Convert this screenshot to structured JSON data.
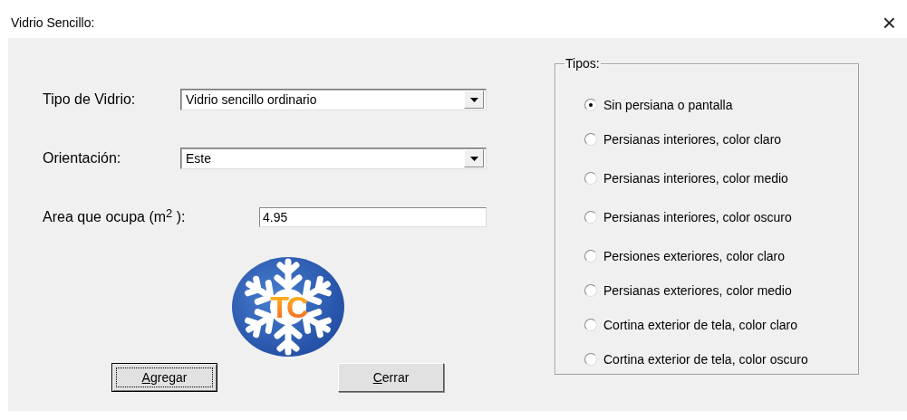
{
  "window": {
    "title": "Vidrio Sencillo:",
    "close": "×"
  },
  "fields": [
    {
      "kind": "combo",
      "label": "Tipo de Vidrio:",
      "value": "Vidrio sencillo ordinario"
    },
    {
      "kind": "combo",
      "label": "Orientación:",
      "value": "Este"
    },
    {
      "kind": "text",
      "label": "Area que ocupa (m$^{2}$ ):",
      "value": "4.95"
    }
  ],
  "logo": {
    "text": "TC"
  },
  "buttons": [
    {
      "label": "Agregar",
      "focused": true,
      "underlined_key": true
    },
    {
      "label": "Cerrar",
      "focused": false,
      "underlined_key": true
    }
  ],
  "group": {
    "title": "Tipos:",
    "options": [
      {
        "label": "Sin persiana o pantalla",
        "selected": true
      },
      {
        "label": "Persianas interiores, color claro",
        "selected": false
      },
      {
        "label": "Persianas interiores, color medio",
        "selected": false
      },
      {
        "label": "Persianas interiores, color oscuro",
        "selected": false
      },
      {
        "label": "Persiones exteriores, color claro",
        "selected": false
      },
      {
        "label": "Persianas exteriores, color medio",
        "selected": false
      },
      {
        "label": "Cortina exterior de tela, color claro",
        "selected": false
      },
      {
        "label": "Cortina exterior de tela, color oscuro",
        "selected": false
      }
    ]
  }
}
